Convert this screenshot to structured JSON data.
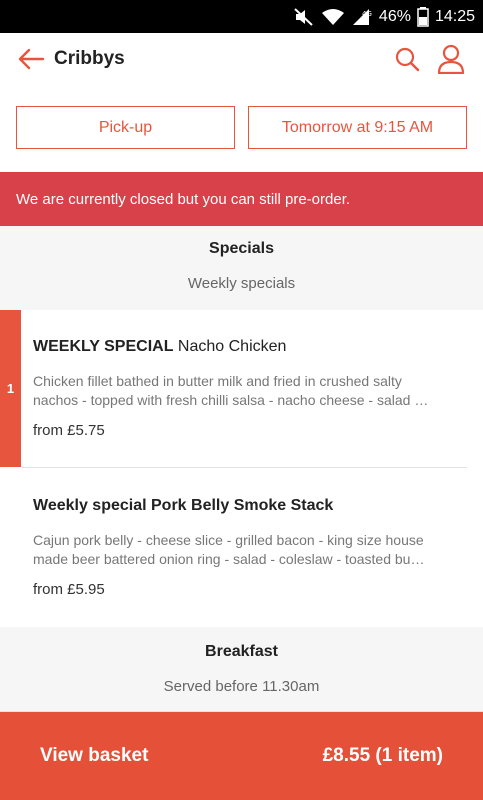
{
  "status_bar": {
    "battery": "46%",
    "time": "14:25",
    "network": "4G",
    "icons": [
      "mute-icon",
      "wifi-icon",
      "signal-icon",
      "battery-icon"
    ]
  },
  "app_bar": {
    "title": "Cribbys",
    "back_icon": "arrow-left-icon",
    "search_icon": "search-icon",
    "account_icon": "user-icon",
    "accent_color": "#e8553f"
  },
  "order_options": {
    "mode_label": "Pick-up",
    "time_label": "Tomorrow at 9:15 AM"
  },
  "banner": {
    "text": "We are currently closed but you can still pre-order.",
    "color": "#d9414a"
  },
  "sections": [
    {
      "title": "Specials",
      "subtitle": "Weekly specials",
      "items": [
        {
          "name_bold": "WEEKLY SPECIAL",
          "name_rest": " Nacho Chicken",
          "desc_line1": "Chicken fillet bathed in butter milk and fried in crushed salty",
          "desc_line2": "nachos - topped with fresh chilli salsa - nacho cheese - salad …",
          "price": "from £5.75",
          "quantity": "1"
        },
        {
          "name_bold": "Weekly special Pork Belly Smoke Stack",
          "name_rest": "",
          "desc_line1": "Cajun pork belly - cheese slice - grilled bacon - king size house",
          "desc_line2": "made beer battered onion ring - salad - coleslaw - toasted bu…",
          "price": "from £5.95",
          "quantity": ""
        }
      ]
    },
    {
      "title": "Breakfast",
      "subtitle": "Served before 11.30am",
      "items": []
    }
  ],
  "basket": {
    "label": "View basket",
    "total": "£8.55 (1 item)",
    "color": "#e55038"
  }
}
